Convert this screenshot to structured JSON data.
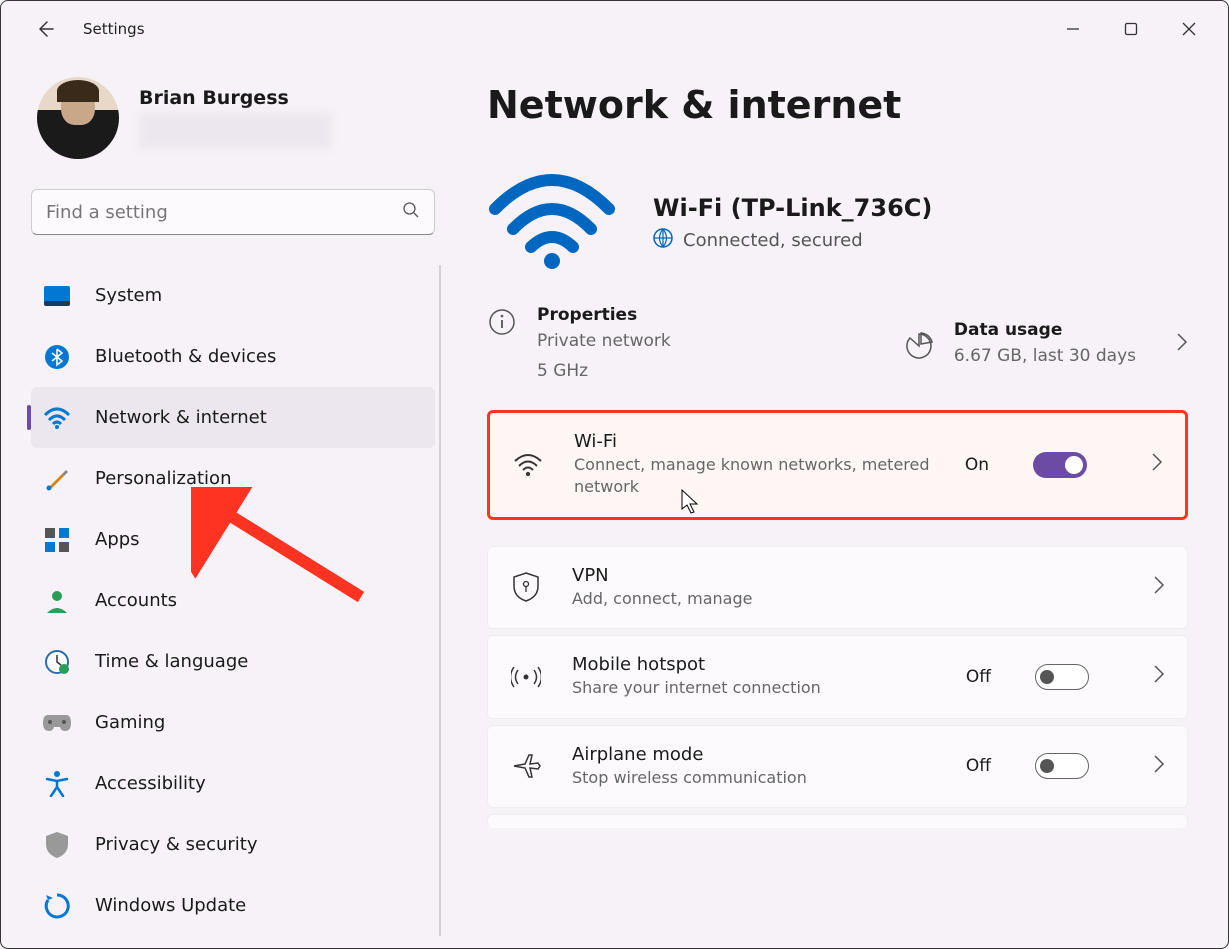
{
  "window": {
    "title": "Settings"
  },
  "user": {
    "name": "Brian Burgess"
  },
  "search": {
    "placeholder": "Find a setting"
  },
  "sidebar": {
    "items": [
      {
        "label": "System",
        "icon": "system-icon",
        "active": false
      },
      {
        "label": "Bluetooth & devices",
        "icon": "bluetooth-icon",
        "active": false
      },
      {
        "label": "Network & internet",
        "icon": "wifi-icon",
        "active": true
      },
      {
        "label": "Personalization",
        "icon": "paint-icon",
        "active": false
      },
      {
        "label": "Apps",
        "icon": "apps-icon",
        "active": false
      },
      {
        "label": "Accounts",
        "icon": "person-icon",
        "active": false
      },
      {
        "label": "Time & language",
        "icon": "clock-icon",
        "active": false
      },
      {
        "label": "Gaming",
        "icon": "gamepad-icon",
        "active": false
      },
      {
        "label": "Accessibility",
        "icon": "accessibility-icon",
        "active": false
      },
      {
        "label": "Privacy & security",
        "icon": "shield-icon",
        "active": false
      },
      {
        "label": "Windows Update",
        "icon": "update-icon",
        "active": false
      }
    ]
  },
  "page": {
    "title": "Network & internet",
    "wifi": {
      "title": "Wi-Fi (TP-Link_736C)",
      "status": "Connected, secured"
    },
    "properties": {
      "title": "Properties",
      "line1": "Private network",
      "line2": "5 GHz"
    },
    "usage": {
      "title": "Data usage",
      "sub": "6.67 GB, last 30 days"
    },
    "settings": [
      {
        "title": "Wi-Fi",
        "sub": "Connect, manage known networks, metered network",
        "icon": "wifi-small-icon",
        "state_label": "On",
        "toggle": "on",
        "highlighted": true
      },
      {
        "title": "VPN",
        "sub": "Add, connect, manage",
        "icon": "vpn-icon",
        "state_label": "",
        "toggle": "none",
        "highlighted": false
      },
      {
        "title": "Mobile hotspot",
        "sub": "Share your internet connection",
        "icon": "hotspot-icon",
        "state_label": "Off",
        "toggle": "off",
        "highlighted": false
      },
      {
        "title": "Airplane mode",
        "sub": "Stop wireless communication",
        "icon": "airplane-icon",
        "state_label": "Off",
        "toggle": "off",
        "highlighted": false
      }
    ]
  }
}
